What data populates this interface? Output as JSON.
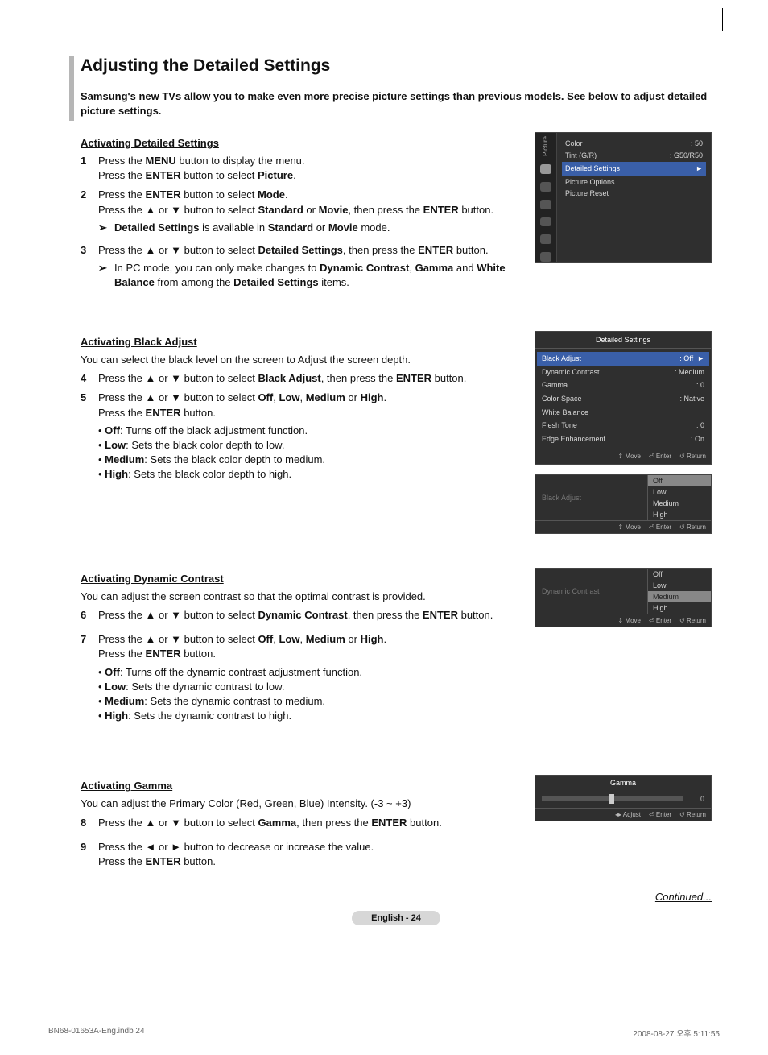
{
  "title": "Adjusting the Detailed Settings",
  "lead": "Samsung's new TVs allow you to make even more precise picture settings than previous models. See below to adjust detailed picture settings.",
  "sec1": {
    "head": "Activating Detailed Settings",
    "steps": {
      "s1a": "Press the ",
      "s1b": "MENU",
      "s1c": " button to display the menu.",
      "s1d": "Press the ",
      "s1e": "ENTER",
      "s1f": " button to select ",
      "s1g": "Picture",
      "s1h": ".",
      "s2a": "Press the ",
      "s2b": "ENTER",
      "s2c": " button to select ",
      "s2d": "Mode",
      "s2e": ".",
      "s2f": "Press the ▲ or ▼ button to select ",
      "s2g": "Standard",
      "s2h": " or ",
      "s2i": "Movie",
      "s2j": ", then press the ",
      "s2k": "ENTER",
      "s2l": " button.",
      "n1a": "Detailed Settings",
      "n1b": " is available in ",
      "n1c": "Standard",
      "n1d": " or ",
      "n1e": "Movie",
      "n1f": " mode.",
      "s3a": "Press the ▲ or ▼ button to select ",
      "s3b": "Detailed Settings",
      "s3c": ", then press the ",
      "s3d": "ENTER",
      "s3e": " button.",
      "n2a": "In PC mode, you can only make changes to ",
      "n2b": "Dynamic Contrast",
      "n2c": ", ",
      "n2d": "Gamma",
      "n2e": " and ",
      "n2f": "White Balance",
      "n2g": " from among the ",
      "n2h": "Detailed Settings",
      "n2i": " items."
    }
  },
  "osd1": {
    "side_label": "Picture",
    "color_l": "Color",
    "color_v": ": 50",
    "tint_l": "Tint (G/R)",
    "tint_v": ": G50/R50",
    "detailed": "Detailed Settings",
    "picopt": "Picture Options",
    "picreset": "Picture Reset"
  },
  "sec2": {
    "head": "Activating Black Adjust",
    "intro": "You can select the black level on the screen to Adjust the screen depth.",
    "s4a": "Press the ▲ or ▼ button to select ",
    "s4b": "Black Adjust",
    "s4c": ", then press the ",
    "s4d": "ENTER",
    "s4e": " button.",
    "s5a": "Press the ▲ or ▼ button to select ",
    "s5b": "Off",
    "s5c": ", ",
    "s5d": "Low",
    "s5e": ", ",
    "s5f": "Medium",
    "s5g": " or ",
    "s5h": "High",
    "s5i": ".",
    "s5j": "Press the ",
    "s5k": "ENTER",
    "s5l": " button.",
    "b1a": "Off",
    "b1b": ": Turns off the black adjustment function.",
    "b2a": "Low",
    "b2b": ": Sets the black color depth to low.",
    "b3a": "Medium",
    "b3b": ": Sets the black color depth to medium.",
    "b4a": "High",
    "b4b": ": Sets the black color depth to high."
  },
  "osd2": {
    "title": "Detailed Settings",
    "r1l": "Black Adjust",
    "r1v": ": Off",
    "r2l": "Dynamic Contrast",
    "r2v": ": Medium",
    "r3l": "Gamma",
    "r3v": ": 0",
    "r4l": "Color Space",
    "r4v": ": Native",
    "r5l": "White Balance",
    "r5v": "",
    "r6l": "Flesh Tone",
    "r6v": ": 0",
    "r7l": "Edge Enhancement",
    "r7v": ": On",
    "move": "Move",
    "enter": "Enter",
    "return": "Return"
  },
  "osd3": {
    "label": "Black Adjust",
    "o1": "Off",
    "o2": "Low",
    "o3": "Medium",
    "o4": "High"
  },
  "sec3": {
    "head": "Activating Dynamic Contrast",
    "intro": "You can adjust the screen contrast so that the optimal contrast is provided.",
    "s6a": "Press the ▲ or ▼ button to select ",
    "s6b": "Dynamic Contrast",
    "s6c": ", then press the ",
    "s6d": "ENTER",
    "s6e": " button.",
    "s7a": "Press the ▲ or ▼ button to select ",
    "s7b": "Off",
    "s7c": ", ",
    "s7d": "Low",
    "s7e": ", ",
    "s7f": "Medium",
    "s7g": " or ",
    "s7h": "High",
    "s7i": ".",
    "s7j": "Press the ",
    "s7k": "ENTER",
    "s7l": " button.",
    "b1a": "Off",
    "b1b": ": Turns off the dynamic contrast adjustment function.",
    "b2a": "Low",
    "b2b": ": Sets the dynamic contrast to low.",
    "b3a": "Medium",
    "b3b": ": Sets the dynamic contrast to medium.",
    "b4a": "High",
    "b4b": ": Sets the dynamic contrast to high."
  },
  "osd4": {
    "label": "Dynamic Contrast",
    "o1": "Off",
    "o2": "Low",
    "o3": "Medium",
    "o4": "High"
  },
  "sec4": {
    "head": "Activating Gamma",
    "intro": "You can adjust the Primary Color (Red, Green, Blue) Intensity. (-3 ~ +3)",
    "s8a": "Press the ▲ or ▼ button to select ",
    "s8b": "Gamma",
    "s8c": ", then press the ",
    "s8d": "ENTER",
    "s8e": " button.",
    "s9a": "Press the ◄ or ► button to decrease or increase the value.",
    "s9b": "Press the ",
    "s9c": "ENTER",
    "s9d": " button."
  },
  "osd5": {
    "title": "Gamma",
    "value": "0",
    "adjust": "Adjust",
    "enter": "Enter",
    "return": "Return"
  },
  "continued": "Continued...",
  "pagebadge": "English - 24",
  "footer": {
    "left": "BN68-01653A-Eng.indb   24",
    "right": "2008-08-27   오후 5:11:55"
  },
  "arrow": "➢",
  "icons": {
    "updown": "⇕",
    "enter": "⏎",
    "ret": "↺",
    "lr": "◂▸"
  }
}
